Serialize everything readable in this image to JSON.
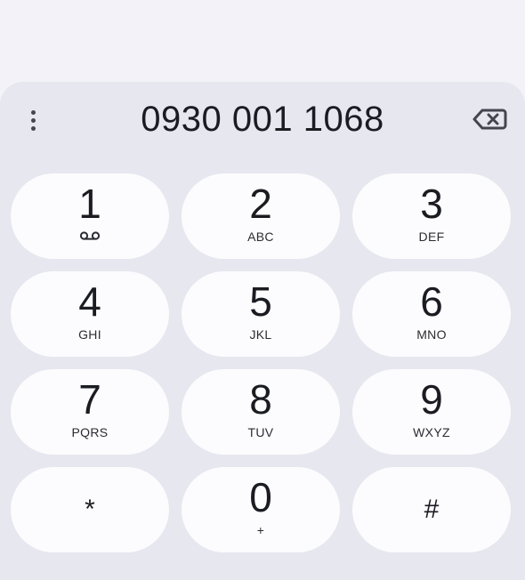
{
  "dialer": {
    "number": "0930 001 1068",
    "more_icon": "more-vertical-icon",
    "backspace_icon": "backspace-icon"
  },
  "keypad": {
    "keys": [
      {
        "digit": "1",
        "letters": "",
        "icon": "voicemail-icon"
      },
      {
        "digit": "2",
        "letters": "ABC"
      },
      {
        "digit": "3",
        "letters": "DEF"
      },
      {
        "digit": "4",
        "letters": "GHI"
      },
      {
        "digit": "5",
        "letters": "JKL"
      },
      {
        "digit": "6",
        "letters": "MNO"
      },
      {
        "digit": "7",
        "letters": "PQRS"
      },
      {
        "digit": "8",
        "letters": "TUV"
      },
      {
        "digit": "9",
        "letters": "WXYZ"
      },
      {
        "digit": "*",
        "letters": ""
      },
      {
        "digit": "0",
        "letters": "+"
      },
      {
        "digit": "#",
        "letters": ""
      }
    ]
  },
  "colors": {
    "background": "#f2f2f8",
    "sheet": "#e6e7ef",
    "key": "#fcfcfe",
    "text": "#1b1c22"
  }
}
